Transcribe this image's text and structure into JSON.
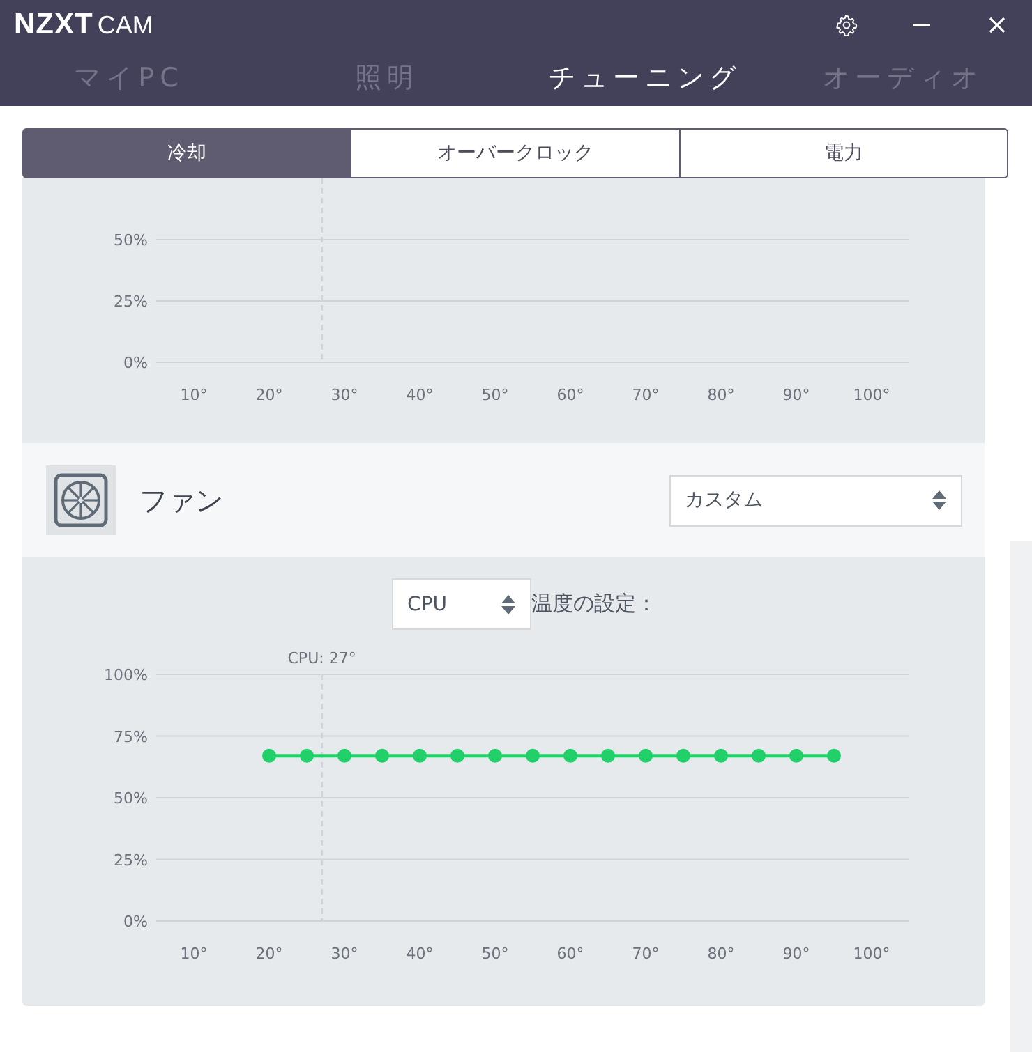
{
  "window": {
    "logo": {
      "brand": "NZXT",
      "product": "CAM"
    }
  },
  "nav_tabs": [
    {
      "label": "マイPC",
      "selected": false
    },
    {
      "label": "照明",
      "selected": false
    },
    {
      "label": "チューニング",
      "selected": true
    },
    {
      "label": "オーディオ",
      "selected": false
    }
  ],
  "sub_tabs": [
    {
      "label": "冷却",
      "selected": true
    },
    {
      "label": "オーバークロック",
      "selected": false
    },
    {
      "label": "電力",
      "selected": false
    }
  ],
  "top_chart": {
    "chart_data": {
      "type": "line",
      "xlim": [
        5,
        105
      ],
      "ylim": [
        0,
        75
      ],
      "grid": true,
      "xticks": [
        {
          "value": 10,
          "label": "10°"
        },
        {
          "value": 20,
          "label": "20°"
        },
        {
          "value": 30,
          "label": "30°"
        },
        {
          "value": 40,
          "label": "40°"
        },
        {
          "value": 50,
          "label": "50°"
        },
        {
          "value": 60,
          "label": "60°"
        },
        {
          "value": 70,
          "label": "70°"
        },
        {
          "value": 80,
          "label": "80°"
        },
        {
          "value": 90,
          "label": "90°"
        },
        {
          "value": 100,
          "label": "100°"
        }
      ],
      "yticks": [
        {
          "value": 0,
          "label": "0%"
        },
        {
          "value": 25,
          "label": "25%"
        },
        {
          "value": 50,
          "label": "50%"
        }
      ],
      "ref_lines": [
        {
          "axis": "x",
          "value": 27
        }
      ]
    }
  },
  "fan": {
    "title": "ファン",
    "mode": "カスタム",
    "source": "CPU",
    "source_label": "温度の設定：",
    "chart_data": {
      "type": "line",
      "xlim": [
        5,
        105
      ],
      "ylim": [
        0,
        100
      ],
      "grid": true,
      "x": [
        20,
        25,
        30,
        35,
        40,
        45,
        50,
        55,
        60,
        65,
        70,
        75,
        80,
        85,
        90,
        95
      ],
      "series": [
        {
          "color": "#22d06a",
          "marker": "o",
          "values": [
            67,
            67,
            67,
            67,
            67,
            67,
            67,
            67,
            67,
            67,
            67,
            67,
            67,
            67,
            67,
            67
          ]
        }
      ],
      "xticks": [
        {
          "value": 10,
          "label": "10°"
        },
        {
          "value": 20,
          "label": "20°"
        },
        {
          "value": 30,
          "label": "30°"
        },
        {
          "value": 40,
          "label": "40°"
        },
        {
          "value": 50,
          "label": "50°"
        },
        {
          "value": 60,
          "label": "60°"
        },
        {
          "value": 70,
          "label": "70°"
        },
        {
          "value": 80,
          "label": "80°"
        },
        {
          "value": 90,
          "label": "90°"
        },
        {
          "value": 100,
          "label": "100°"
        }
      ],
      "yticks": [
        {
          "value": 0,
          "label": "0%"
        },
        {
          "value": 25,
          "label": "25%"
        },
        {
          "value": 50,
          "label": "50%"
        },
        {
          "value": 75,
          "label": "75%"
        },
        {
          "value": 100,
          "label": "100%"
        }
      ],
      "ref_lines": [
        {
          "axis": "x",
          "value": 27,
          "label": "CPU: 27°"
        }
      ]
    }
  }
}
